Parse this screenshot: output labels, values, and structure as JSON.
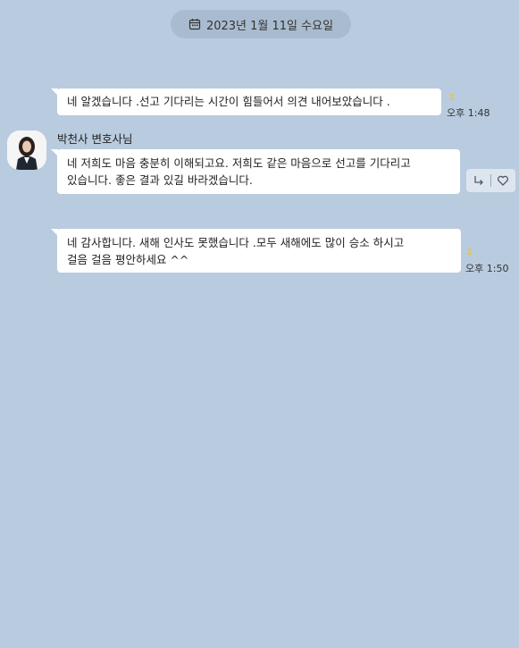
{
  "date_divider": {
    "label": "2023년 1월 11일 수요일",
    "icon": "calendar-icon"
  },
  "messages": [
    {
      "text": "네 알겠습니다 .선고  기다리는 시간이 힘들어서 의견 내어보았습니다 .",
      "time": "오후 1:48",
      "unread": "1"
    },
    {
      "sender": "박천사 변호사님",
      "line1": "네 저희도 마음 충분히 이해되고요. 저희도 같은 마음으로 선고를 기다리고",
      "line2": "있습니다. 좋은 결과 있길 바라겠습니다.",
      "actions": {
        "reply_icon": "reply-arrow-icon",
        "like_icon": "heart-icon"
      }
    },
    {
      "line1": "네 감사합니다. 새해 인사도 못했습니다 .모두 새해에도 많이 승소 하시고",
      "line2": "걸음 걸음 평안하세요 ^^",
      "time": "오후 1:50",
      "unread": "1"
    }
  ]
}
